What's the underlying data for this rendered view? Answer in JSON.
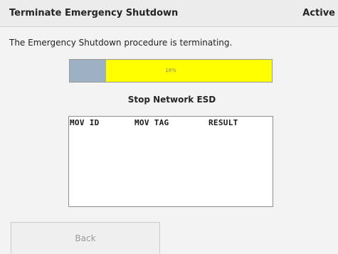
{
  "header": {
    "title": "Terminate Emergency Shutdown",
    "status": "Active"
  },
  "message": "The Emergency Shutdown procedure is terminating.",
  "progress": {
    "percent": 18,
    "label": "18%"
  },
  "section_title": "Stop Network ESD",
  "table": {
    "columns": [
      "MOV ID",
      "MOV TAG",
      "RESULT"
    ],
    "rows": []
  },
  "buttons": {
    "back_label": "Back"
  },
  "colors": {
    "progress_fill": "#9eb0c4",
    "progress_track": "#ffff00"
  }
}
